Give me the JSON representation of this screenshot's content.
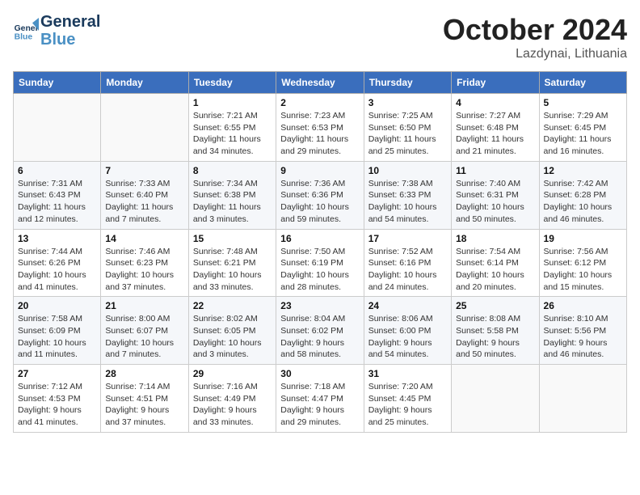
{
  "header": {
    "logo_line1": "General",
    "logo_line2": "Blue",
    "month_year": "October 2024",
    "location": "Lazdynai, Lithuania"
  },
  "calendar": {
    "days_of_week": [
      "Sunday",
      "Monday",
      "Tuesday",
      "Wednesday",
      "Thursday",
      "Friday",
      "Saturday"
    ],
    "weeks": [
      [
        {
          "day": "",
          "sunrise": "",
          "sunset": "",
          "daylight": ""
        },
        {
          "day": "",
          "sunrise": "",
          "sunset": "",
          "daylight": ""
        },
        {
          "day": "1",
          "sunrise": "Sunrise: 7:21 AM",
          "sunset": "Sunset: 6:55 PM",
          "daylight": "Daylight: 11 hours and 34 minutes."
        },
        {
          "day": "2",
          "sunrise": "Sunrise: 7:23 AM",
          "sunset": "Sunset: 6:53 PM",
          "daylight": "Daylight: 11 hours and 29 minutes."
        },
        {
          "day": "3",
          "sunrise": "Sunrise: 7:25 AM",
          "sunset": "Sunset: 6:50 PM",
          "daylight": "Daylight: 11 hours and 25 minutes."
        },
        {
          "day": "4",
          "sunrise": "Sunrise: 7:27 AM",
          "sunset": "Sunset: 6:48 PM",
          "daylight": "Daylight: 11 hours and 21 minutes."
        },
        {
          "day": "5",
          "sunrise": "Sunrise: 7:29 AM",
          "sunset": "Sunset: 6:45 PM",
          "daylight": "Daylight: 11 hours and 16 minutes."
        }
      ],
      [
        {
          "day": "6",
          "sunrise": "Sunrise: 7:31 AM",
          "sunset": "Sunset: 6:43 PM",
          "daylight": "Daylight: 11 hours and 12 minutes."
        },
        {
          "day": "7",
          "sunrise": "Sunrise: 7:33 AM",
          "sunset": "Sunset: 6:40 PM",
          "daylight": "Daylight: 11 hours and 7 minutes."
        },
        {
          "day": "8",
          "sunrise": "Sunrise: 7:34 AM",
          "sunset": "Sunset: 6:38 PM",
          "daylight": "Daylight: 11 hours and 3 minutes."
        },
        {
          "day": "9",
          "sunrise": "Sunrise: 7:36 AM",
          "sunset": "Sunset: 6:36 PM",
          "daylight": "Daylight: 10 hours and 59 minutes."
        },
        {
          "day": "10",
          "sunrise": "Sunrise: 7:38 AM",
          "sunset": "Sunset: 6:33 PM",
          "daylight": "Daylight: 10 hours and 54 minutes."
        },
        {
          "day": "11",
          "sunrise": "Sunrise: 7:40 AM",
          "sunset": "Sunset: 6:31 PM",
          "daylight": "Daylight: 10 hours and 50 minutes."
        },
        {
          "day": "12",
          "sunrise": "Sunrise: 7:42 AM",
          "sunset": "Sunset: 6:28 PM",
          "daylight": "Daylight: 10 hours and 46 minutes."
        }
      ],
      [
        {
          "day": "13",
          "sunrise": "Sunrise: 7:44 AM",
          "sunset": "Sunset: 6:26 PM",
          "daylight": "Daylight: 10 hours and 41 minutes."
        },
        {
          "day": "14",
          "sunrise": "Sunrise: 7:46 AM",
          "sunset": "Sunset: 6:23 PM",
          "daylight": "Daylight: 10 hours and 37 minutes."
        },
        {
          "day": "15",
          "sunrise": "Sunrise: 7:48 AM",
          "sunset": "Sunset: 6:21 PM",
          "daylight": "Daylight: 10 hours and 33 minutes."
        },
        {
          "day": "16",
          "sunrise": "Sunrise: 7:50 AM",
          "sunset": "Sunset: 6:19 PM",
          "daylight": "Daylight: 10 hours and 28 minutes."
        },
        {
          "day": "17",
          "sunrise": "Sunrise: 7:52 AM",
          "sunset": "Sunset: 6:16 PM",
          "daylight": "Daylight: 10 hours and 24 minutes."
        },
        {
          "day": "18",
          "sunrise": "Sunrise: 7:54 AM",
          "sunset": "Sunset: 6:14 PM",
          "daylight": "Daylight: 10 hours and 20 minutes."
        },
        {
          "day": "19",
          "sunrise": "Sunrise: 7:56 AM",
          "sunset": "Sunset: 6:12 PM",
          "daylight": "Daylight: 10 hours and 15 minutes."
        }
      ],
      [
        {
          "day": "20",
          "sunrise": "Sunrise: 7:58 AM",
          "sunset": "Sunset: 6:09 PM",
          "daylight": "Daylight: 10 hours and 11 minutes."
        },
        {
          "day": "21",
          "sunrise": "Sunrise: 8:00 AM",
          "sunset": "Sunset: 6:07 PM",
          "daylight": "Daylight: 10 hours and 7 minutes."
        },
        {
          "day": "22",
          "sunrise": "Sunrise: 8:02 AM",
          "sunset": "Sunset: 6:05 PM",
          "daylight": "Daylight: 10 hours and 3 minutes."
        },
        {
          "day": "23",
          "sunrise": "Sunrise: 8:04 AM",
          "sunset": "Sunset: 6:02 PM",
          "daylight": "Daylight: 9 hours and 58 minutes."
        },
        {
          "day": "24",
          "sunrise": "Sunrise: 8:06 AM",
          "sunset": "Sunset: 6:00 PM",
          "daylight": "Daylight: 9 hours and 54 minutes."
        },
        {
          "day": "25",
          "sunrise": "Sunrise: 8:08 AM",
          "sunset": "Sunset: 5:58 PM",
          "daylight": "Daylight: 9 hours and 50 minutes."
        },
        {
          "day": "26",
          "sunrise": "Sunrise: 8:10 AM",
          "sunset": "Sunset: 5:56 PM",
          "daylight": "Daylight: 9 hours and 46 minutes."
        }
      ],
      [
        {
          "day": "27",
          "sunrise": "Sunrise: 7:12 AM",
          "sunset": "Sunset: 4:53 PM",
          "daylight": "Daylight: 9 hours and 41 minutes."
        },
        {
          "day": "28",
          "sunrise": "Sunrise: 7:14 AM",
          "sunset": "Sunset: 4:51 PM",
          "daylight": "Daylight: 9 hours and 37 minutes."
        },
        {
          "day": "29",
          "sunrise": "Sunrise: 7:16 AM",
          "sunset": "Sunset: 4:49 PM",
          "daylight": "Daylight: 9 hours and 33 minutes."
        },
        {
          "day": "30",
          "sunrise": "Sunrise: 7:18 AM",
          "sunset": "Sunset: 4:47 PM",
          "daylight": "Daylight: 9 hours and 29 minutes."
        },
        {
          "day": "31",
          "sunrise": "Sunrise: 7:20 AM",
          "sunset": "Sunset: 4:45 PM",
          "daylight": "Daylight: 9 hours and 25 minutes."
        },
        {
          "day": "",
          "sunrise": "",
          "sunset": "",
          "daylight": ""
        },
        {
          "day": "",
          "sunrise": "",
          "sunset": "",
          "daylight": ""
        }
      ]
    ]
  }
}
